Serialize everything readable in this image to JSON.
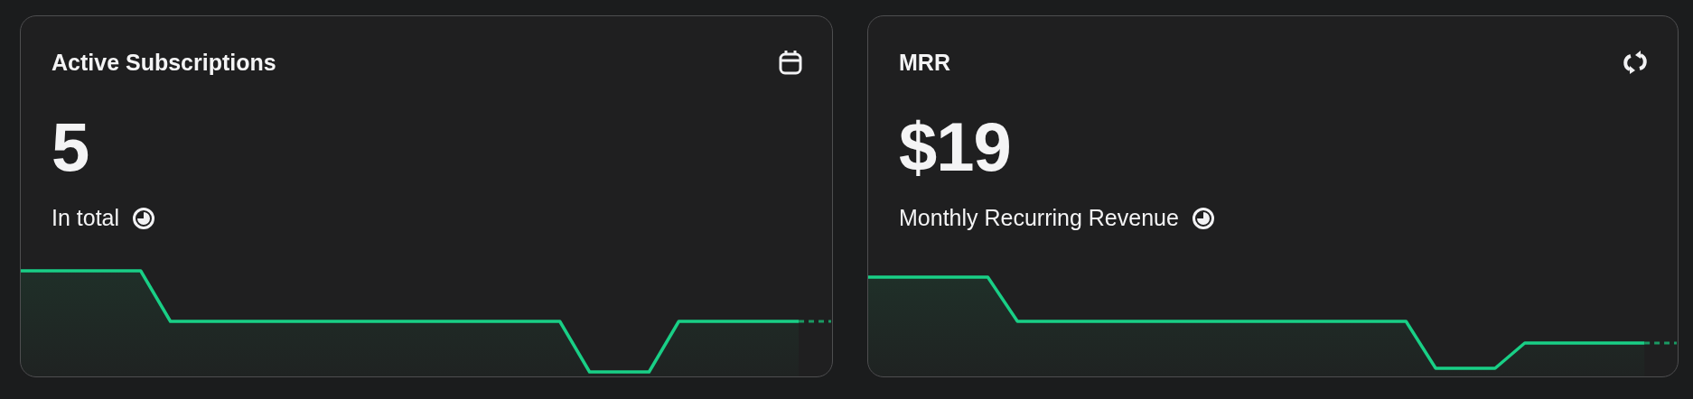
{
  "cards": [
    {
      "title": "Active Subscriptions",
      "kind": "calendar",
      "value": "5",
      "caption": "In total"
    },
    {
      "title": "MRR",
      "kind": "refresh",
      "value": "$19",
      "caption": "Monthly Recurring Revenue"
    }
  ]
}
